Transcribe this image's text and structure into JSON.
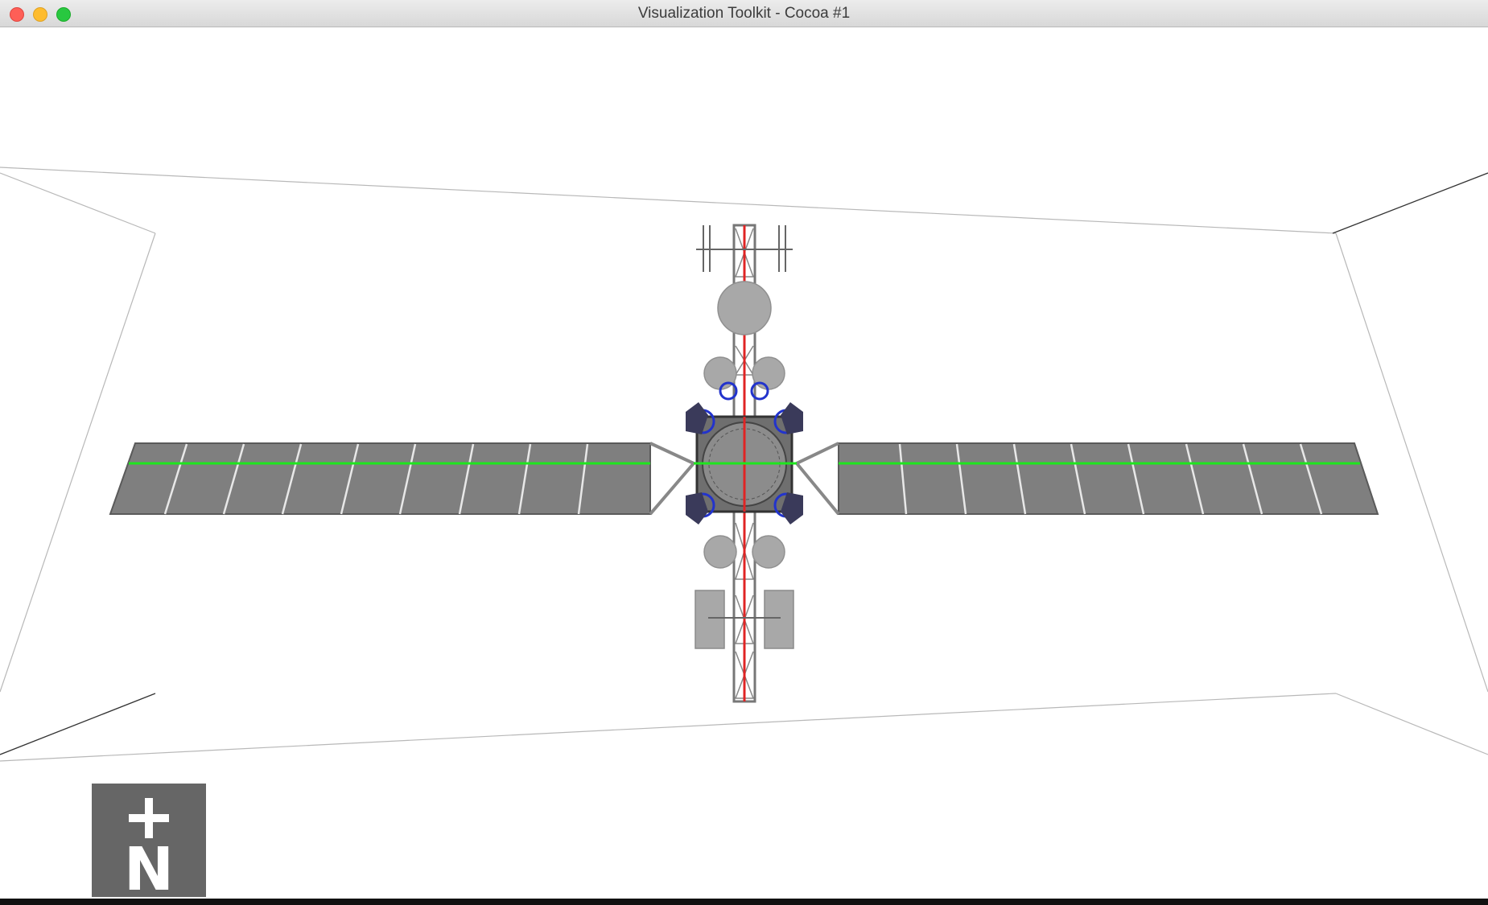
{
  "window": {
    "title": "Visualization Toolkit - Cocoa #1",
    "buttons": [
      "close",
      "minimize",
      "zoom"
    ]
  },
  "scene": {
    "background_color": "#ffffff",
    "model": "satellite",
    "panel_color": "#7f7f7f",
    "axis_color_vertical": "#e02424",
    "axis_color_horizontal": "#1ee61e",
    "fixture_color": "#2233cc"
  },
  "orientation_widget": {
    "icon": "plus-north-icon",
    "glyph_label": "N",
    "background_color": "#666666"
  }
}
